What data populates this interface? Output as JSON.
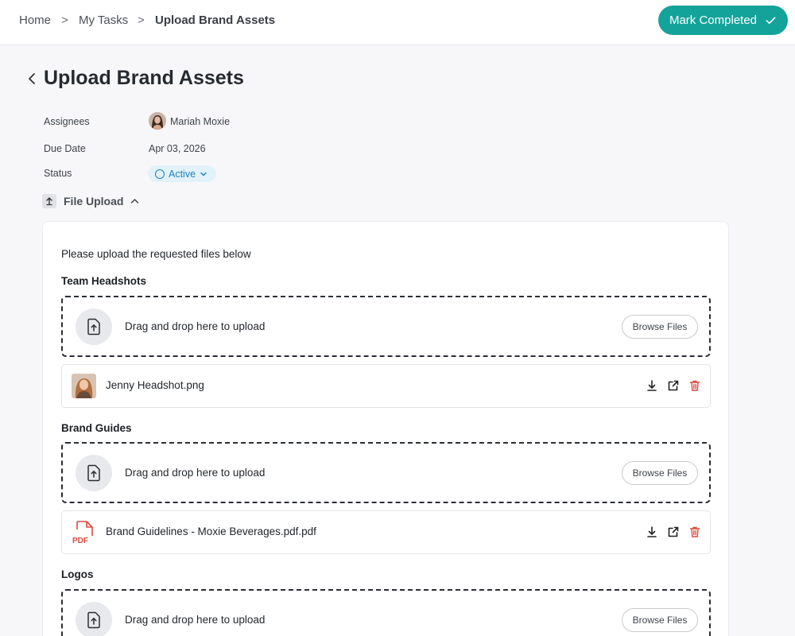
{
  "breadcrumb": {
    "items": [
      "Home",
      "My Tasks",
      "Upload Brand Assets"
    ],
    "separator": ">"
  },
  "header": {
    "mark_completed_label": "Mark Completed"
  },
  "page": {
    "title": "Upload Brand Assets"
  },
  "meta": {
    "assignees_label": "Assignees",
    "assignee_name": "Mariah Moxie",
    "due_date_label": "Due Date",
    "due_date_value": "Apr 03, 2026",
    "status_label": "Status",
    "status_value": "Active"
  },
  "file_upload": {
    "section_title": "File Upload",
    "intro": "Please upload the requested files below",
    "dropzone_text": "Drag and drop here to upload",
    "browse_label": "Browse Files",
    "groups": [
      {
        "title": "Team Headshots",
        "files": [
          {
            "name": "Jenny Headshot.png",
            "type": "image"
          }
        ]
      },
      {
        "title": "Brand Guides",
        "files": [
          {
            "name": "Brand Guidelines - Moxie Beverages.pdf.pdf",
            "type": "pdf",
            "badge": "PDF"
          }
        ]
      },
      {
        "title": "Logos",
        "files": []
      }
    ]
  },
  "colors": {
    "accent": "#14a39a",
    "status": "#1f80b8",
    "delete": "#e0493f",
    "pdf": "#e0493f"
  },
  "icons": [
    "chevron-right-icon",
    "check-icon",
    "chevron-left-icon",
    "chevron-down-icon",
    "upload-icon",
    "chevron-up-icon",
    "file-upload-icon",
    "download-icon",
    "external-link-icon",
    "trash-icon",
    "pdf-icon"
  ]
}
